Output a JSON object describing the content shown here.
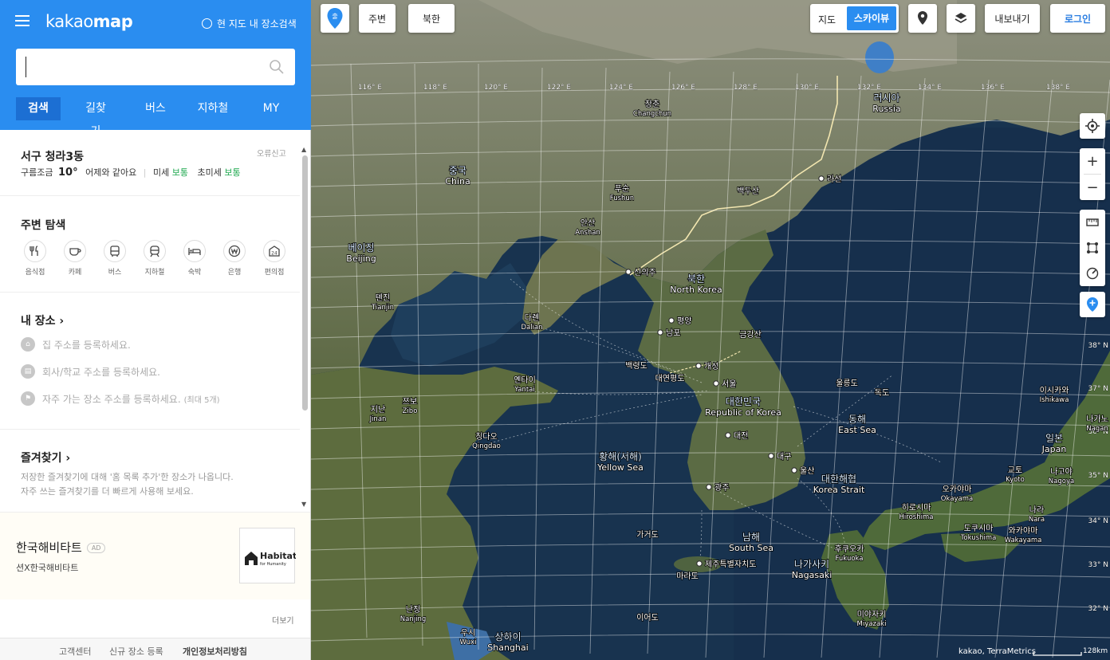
{
  "header": {
    "logo_a": "kakao",
    "logo_b": "map",
    "here_search": "현 지도 내 장소검색",
    "search_value": "",
    "tabs": [
      "검색",
      "길찾기",
      "버스",
      "지하철",
      "MY"
    ]
  },
  "weather": {
    "location": "서구 청라3동",
    "report": "오류신고",
    "condition": "구름조금",
    "temp": "10°",
    "compare": "어제와 같아요",
    "dust_label": "미세",
    "dust_value": "보통",
    "ultra_label": "초미세",
    "ultra_value": "보통"
  },
  "nearby": {
    "title": "주변 탐색",
    "items": [
      {
        "label": "음식점",
        "icon": "fork-icon"
      },
      {
        "label": "카페",
        "icon": "cafe-icon"
      },
      {
        "label": "버스",
        "icon": "bus-icon"
      },
      {
        "label": "지하철",
        "icon": "subway-icon"
      },
      {
        "label": "숙박",
        "icon": "bed-icon"
      },
      {
        "label": "은행",
        "icon": "bank-icon"
      },
      {
        "label": "편의점",
        "icon": "store-24-icon"
      }
    ],
    "store_glyph": "24"
  },
  "myplace": {
    "title": "내 장소",
    "home": "집 주소를 등록하세요.",
    "office": "회사/학교 주소를 등록하세요.",
    "frequent": "자주 가는 장소 주소를 등록하세요.",
    "frequent_note": "(최대 5개)"
  },
  "favorites": {
    "title": "즐겨찾기",
    "line1": "저장한 즐겨찾기에 대해 '홈 목록 추가'한 장소가 나옵니다.",
    "line2": "자주 쓰는 즐겨찾기를 더 빠르게 사용해 보세요."
  },
  "ad": {
    "title": "한국해비타트",
    "badge": "AD",
    "sub": "션X한국해비타트",
    "logo_top": "Habitat",
    "logo_bottom": "for Humanity"
  },
  "more": "더보기",
  "footer": [
    "고객센터",
    "신규 장소 등록",
    "개인정보처리방침"
  ],
  "map_controls": {
    "nearby": "주변",
    "north_korea": "북한",
    "type_map": "지도",
    "type_sky": "스카이뷰",
    "export": "내보내기",
    "login": "로그인",
    "pin_badge": "출"
  },
  "copyright": "kakao, TerraMetrics",
  "scale": "128km",
  "map": {
    "lon_labels": [
      "116° E",
      "118° E",
      "120° E",
      "122° E",
      "124° E",
      "126° E",
      "128° E",
      "130° E",
      "132° E",
      "134° E",
      "136° E",
      "138° E"
    ],
    "lat_labels": [
      "38° N",
      "37° N",
      "36° N",
      "35° N",
      "34° N",
      "33° N",
      "32° N"
    ],
    "places": [
      {
        "ko": "러시아",
        "en": "Russia",
        "big": true
      },
      {
        "ko": "창춘",
        "en": "Changchun"
      },
      {
        "ko": "중국",
        "en": "China",
        "big": true
      },
      {
        "ko": "라선",
        "en": ""
      },
      {
        "ko": "백두산",
        "en": ""
      },
      {
        "ko": "푸순",
        "en": "Fushun"
      },
      {
        "ko": "안산",
        "en": "Anshan"
      },
      {
        "ko": "베이징",
        "en": "Beijing",
        "big": true
      },
      {
        "ko": "신의주",
        "en": ""
      },
      {
        "ko": "북한",
        "en": "North Korea",
        "big": true
      },
      {
        "ko": "톈진",
        "en": "Tianjin"
      },
      {
        "ko": "다롄",
        "en": "Dalian"
      },
      {
        "ko": "평양",
        "en": ""
      },
      {
        "ko": "남포",
        "en": ""
      },
      {
        "ko": "금강산",
        "en": ""
      },
      {
        "ko": "백령도",
        "en": ""
      },
      {
        "ko": "개성",
        "en": ""
      },
      {
        "ko": "대연평도",
        "en": ""
      },
      {
        "ko": "옌타이",
        "en": "Yantai"
      },
      {
        "ko": "서울",
        "en": ""
      },
      {
        "ko": "울릉도",
        "en": ""
      },
      {
        "ko": "독도",
        "en": ""
      },
      {
        "ko": "대한민국",
        "en": "Republic of Korea",
        "big": true
      },
      {
        "ko": "지난",
        "en": "Jinan"
      },
      {
        "ko": "쯔보",
        "en": "Zibo"
      },
      {
        "ko": "동해",
        "en": "East Sea",
        "big": true
      },
      {
        "ko": "칭다오",
        "en": "Qingdao"
      },
      {
        "ko": "대전",
        "en": ""
      },
      {
        "ko": "황해(서해)",
        "en": "Yellow Sea",
        "big": true
      },
      {
        "ko": "대구",
        "en": ""
      },
      {
        "ko": "대한해협",
        "en": "Korea Strait",
        "big": true
      },
      {
        "ko": "울산",
        "en": ""
      },
      {
        "ko": "광주",
        "en": ""
      },
      {
        "ko": "이시카와",
        "en": "Ishikawa"
      },
      {
        "ko": "나가노",
        "en": "Nagan"
      },
      {
        "ko": "일본",
        "en": "Japan",
        "big": true
      },
      {
        "ko": "교토",
        "en": "Kyoto"
      },
      {
        "ko": "나고야",
        "en": "Nagoya"
      },
      {
        "ko": "오카야마",
        "en": "Okayama"
      },
      {
        "ko": "히로시마",
        "en": "Hiroshima"
      },
      {
        "ko": "나라",
        "en": "Nara"
      },
      {
        "ko": "도쿠시마",
        "en": "Tokushima"
      },
      {
        "ko": "와카야마",
        "en": "Wakayama"
      },
      {
        "ko": "가거도",
        "en": ""
      },
      {
        "ko": "남해",
        "en": "South Sea",
        "big": true
      },
      {
        "ko": "후쿠오카",
        "en": "Fukuoka"
      },
      {
        "ko": "제주특별자치도",
        "en": ""
      },
      {
        "ko": "나가사키",
        "en": "Nagasaki",
        "big": true
      },
      {
        "ko": "마라도",
        "en": ""
      },
      {
        "ko": "미야자키",
        "en": "Miyazaki"
      },
      {
        "ko": "난징",
        "en": "Nanjing"
      },
      {
        "ko": "이어도",
        "en": ""
      },
      {
        "ko": "우시",
        "en": "Wuxi"
      },
      {
        "ko": "상하이",
        "en": "Shanghai",
        "big": true
      }
    ]
  }
}
